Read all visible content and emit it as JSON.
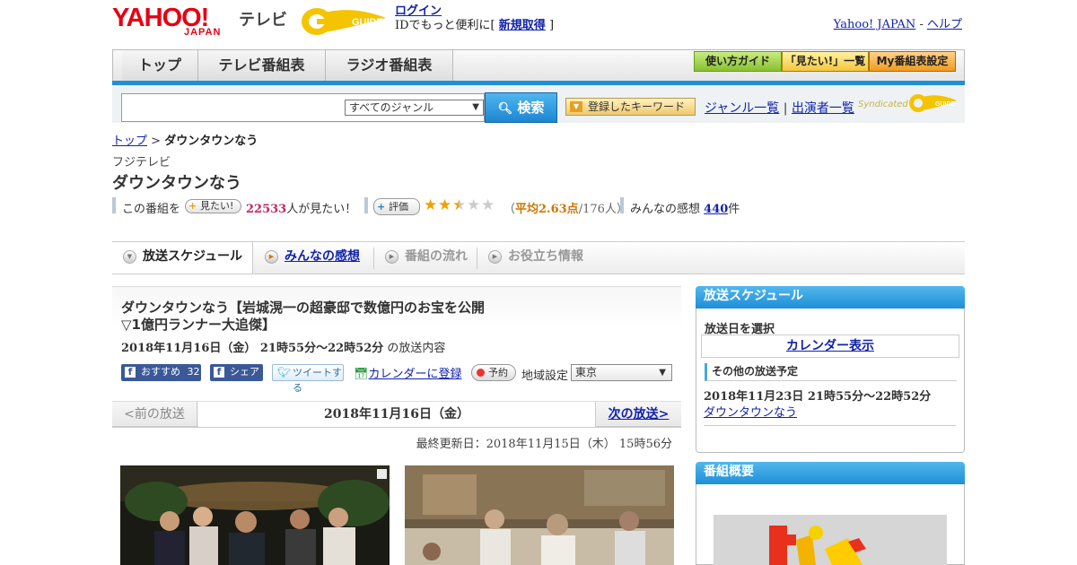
{
  "header": {
    "logo_main": "YAHOO!",
    "logo_sub": "JAPAN",
    "tv_label": "テレビ",
    "gguide": "G GUIDE",
    "login_label": "ログイン",
    "login_text": "IDでもっと便利に[",
    "register_label": "新規取得",
    "register_close": "]",
    "yahoo_japan_link": "Yahoo! JAPAN",
    "link_sep": "-",
    "help_link": "ヘルプ"
  },
  "nav": {
    "tabs": [
      "トップ",
      "テレビ番組表",
      "ラジオ番組表"
    ],
    "guide_buttons": [
      "使い方ガイド",
      "「見たい!」一覧",
      "My番組表設定"
    ]
  },
  "search": {
    "placeholder": "",
    "genre_selected": "すべてのジャンル",
    "search_button": "検索",
    "keyword_button": "登録したキーワード",
    "genre_list_link": "ジャンル一覧",
    "sep": "|",
    "cast_list_link": "出演者一覧",
    "syndicated": "Syndicated"
  },
  "breadcrumb": {
    "top": "トップ",
    "sep": ">",
    "current": "ダウンタウンなう"
  },
  "program": {
    "channel": "フジテレビ",
    "title": "ダウンタウンなう",
    "this_program_label": "この番組を",
    "mitai_button": "見たい!",
    "mitai_count": "22533",
    "mitai_suffix": "人が見たい！",
    "rate_button": "評価",
    "rating": 2.63,
    "rating_open": "（",
    "rating_avg_text": "平均2.63点",
    "rating_count_text": "/176人）",
    "impressions_label": "みんなの感想",
    "impressions_count": "440",
    "impressions_suffix": "件"
  },
  "tabs": [
    {
      "label": "放送スケジュール",
      "state": "active"
    },
    {
      "label": "みんなの感想",
      "state": "link"
    },
    {
      "label": "番組の流れ",
      "state": "disabled"
    },
    {
      "label": "お役立ち情報",
      "state": "disabled"
    }
  ],
  "episode": {
    "title_line1": "ダウンタウンなう【岩城滉一の超豪邸で数億円のお宝を公開",
    "title_line2": "▽1億円ランナー大追傑】",
    "date": "2018年11月16日（金）  21時55分～22時52分",
    "date_suffix": " の放送内容",
    "fb_recommend": "おすすめ",
    "fb_count": "32",
    "fb_share": "シェア",
    "tweet": "ツイートする",
    "calendar_link": "カレンダーに登録",
    "reserve": "予約",
    "region_label": "地域設定",
    "region_value": "東京"
  },
  "pager": {
    "prev": "<前の放送",
    "current": "2018年11月16日（金）",
    "next": "次の放送>"
  },
  "updated": "最終更新日：2018年11月15日（木）  15時56分",
  "sidebar": {
    "schedule_head": "放送スケジュール",
    "select_date": "放送日を選択",
    "calendar_button": "カレンダー表示",
    "other_head": "その他の放送予定",
    "other_date": "2018年11月23日  21時55分～22時52分",
    "other_link": "ダウンタウンなう",
    "overview_head": "番組概要"
  },
  "colors": {
    "accent_blue": "#1f8fd6",
    "yahoo_red": "#e60012",
    "count_pink": "#cc2266",
    "rating_orange": "#cc7700",
    "star_gold": "#f0a000"
  }
}
